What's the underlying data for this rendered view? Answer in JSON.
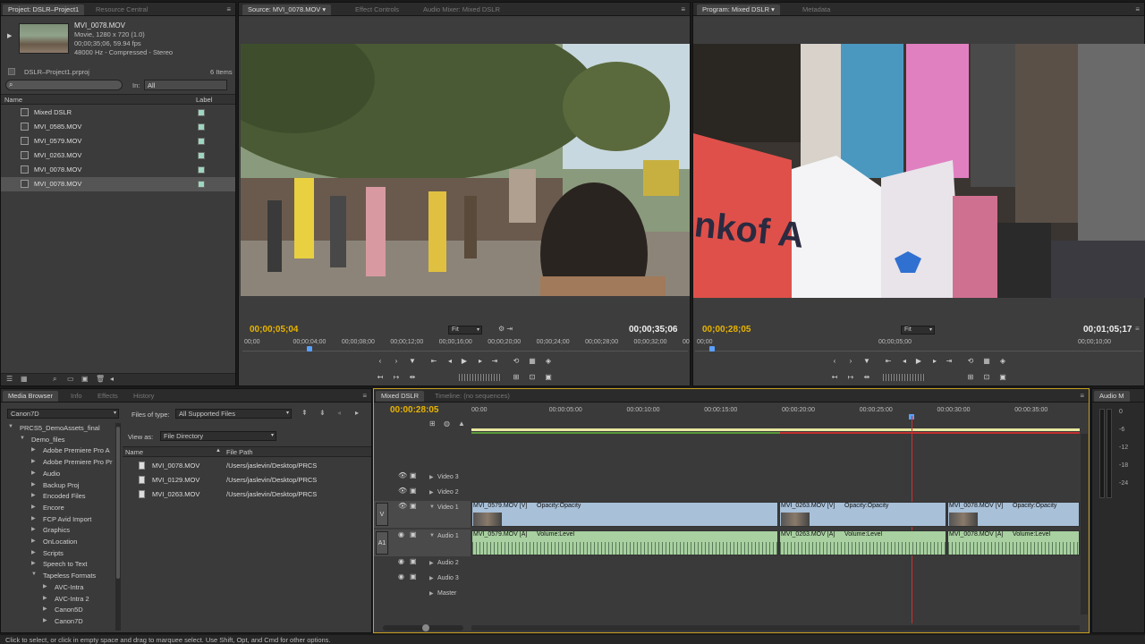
{
  "project": {
    "tabs": [
      "Project: DSLR–Project1",
      "Resource Central"
    ],
    "clip_name": "MVI_0078.MOV",
    "clip_info": [
      "Movie, 1280 x 720 (1.0)",
      "00;00;35;06, 59.94 fps",
      "48000 Hz - Compressed - Stereo"
    ],
    "project_file": "DSLR–Project1.prproj",
    "item_count": "6 Items",
    "in_label": "In:",
    "in_value": "All",
    "col_name": "Name",
    "col_label": "Label",
    "items": [
      {
        "name": "Mixed DSLR",
        "type": "sequence"
      },
      {
        "name": "MVI_0585.MOV",
        "type": "clip"
      },
      {
        "name": "MVI_0579.MOV",
        "type": "clip"
      },
      {
        "name": "MVI_0263.MOV",
        "type": "clip"
      },
      {
        "name": "MVI_0078.MOV",
        "type": "clip"
      },
      {
        "name": "MVI_0078.MOV",
        "type": "clip"
      }
    ]
  },
  "source": {
    "tabs": [
      "Source: MVI_0078.MOV",
      "Effect Controls",
      "Audio Mixer: Mixed DSLR"
    ],
    "timecode_current": "00;00;05;04",
    "timecode_duration": "00;00;35;06",
    "fit": "Fit",
    "ruler": [
      "00;00",
      "00;00;04;00",
      "00;00;08;00",
      "00;00;12;00",
      "00;00;16;00",
      "00;00;20;00",
      "00;00;24;00",
      "00;00;28;00",
      "00;00;32;00",
      "00"
    ]
  },
  "program": {
    "tabs": [
      "Program: Mixed DSLR",
      "Metadata"
    ],
    "timecode_current": "00;00;28;05",
    "timecode_duration": "00;01;05;17",
    "fit": "Fit",
    "ruler": [
      "00;00",
      "00;00;05;00",
      "00;00;10;00"
    ],
    "billboard_text": "nkof A"
  },
  "media_browser": {
    "tabs": [
      "Media Browser",
      "Info",
      "Effects",
      "History"
    ],
    "drive": "Canon7D",
    "files_of_type_label": "Files of type:",
    "files_of_type": "All Supported Files",
    "view_as_label": "View as:",
    "view_as": "File Directory",
    "tree": [
      {
        "label": "PRCS5_DemoAssets_final",
        "level": 0,
        "open": true
      },
      {
        "label": "Demo_files",
        "level": 1,
        "open": true
      },
      {
        "label": "Adobe Premiere Pro A",
        "level": 2
      },
      {
        "label": "Adobe Premiere Pro Pr",
        "level": 2
      },
      {
        "label": "Audio",
        "level": 2
      },
      {
        "label": "Backup Proj",
        "level": 2
      },
      {
        "label": "Encoded Files",
        "level": 2
      },
      {
        "label": "Encore",
        "level": 2
      },
      {
        "label": "FCP Avid Import",
        "level": 2
      },
      {
        "label": "Graphics",
        "level": 2
      },
      {
        "label": "OnLocation",
        "level": 2
      },
      {
        "label": "Scripts",
        "level": 2
      },
      {
        "label": "Speech to Text",
        "level": 2
      },
      {
        "label": "Tapeless Formats",
        "level": 2,
        "open": true
      },
      {
        "label": "AVC-Intra",
        "level": 3
      },
      {
        "label": "AVC-Intra 2",
        "level": 3
      },
      {
        "label": "Canon5D",
        "level": 3
      },
      {
        "label": "Canon7D",
        "level": 3
      }
    ],
    "col_name": "Name",
    "col_path": "File Path",
    "files": [
      {
        "name": "MVI_0078.MOV",
        "path": "/Users/jaslevin/Desktop/PRCS"
      },
      {
        "name": "MVI_0129.MOV",
        "path": "/Users/jaslevin/Desktop/PRCS"
      },
      {
        "name": "MVI_0263.MOV",
        "path": "/Users/jaslevin/Desktop/PRCS"
      }
    ]
  },
  "timeline": {
    "tabs": [
      "Mixed DSLR",
      "Timeline: (no sequences)"
    ],
    "timecode": "00:00:28:05",
    "ruler": [
      "00:00",
      "00:00:05:00",
      "00:00:10:00",
      "00:00:15:00",
      "00:00:20:00",
      "00:00:25:00",
      "00:00:30:00",
      "00:00:35:00",
      "0"
    ],
    "tracks": {
      "video3": "Video 3",
      "video2": "Video 2",
      "video1": "Video 1",
      "audio1": "Audio 1",
      "audio2": "Audio 2",
      "audio3": "Audio 3",
      "master": "Master",
      "v": "V",
      "a1": "A1"
    },
    "video_clips": [
      {
        "label": "MVI_0579.MOV [V]",
        "fx": "Opacity:Opacity"
      },
      {
        "label": "MVI_0263.MOV [V]",
        "fx": "Opacity:Opacity"
      },
      {
        "label": "MVI_0078.MOV [V]",
        "fx": "Opacity:Opacity"
      }
    ],
    "audio_clips": [
      {
        "label": "MVI_0579.MOV [A]",
        "fx": "Volume:Level"
      },
      {
        "label": "MVI_0263.MOV [A]",
        "fx": "Volume:Level"
      },
      {
        "label": "MVI_0078.MOV [A]",
        "fx": "Volume:Level"
      }
    ]
  },
  "audio_meter": {
    "tab": "Audio M",
    "ticks": [
      "0",
      "-6",
      "-12",
      "-18",
      "-24"
    ]
  },
  "status_bar": "Click to select, or click in empty space and drag to marquee select. Use Shift, Opt, and Cmd for other options."
}
